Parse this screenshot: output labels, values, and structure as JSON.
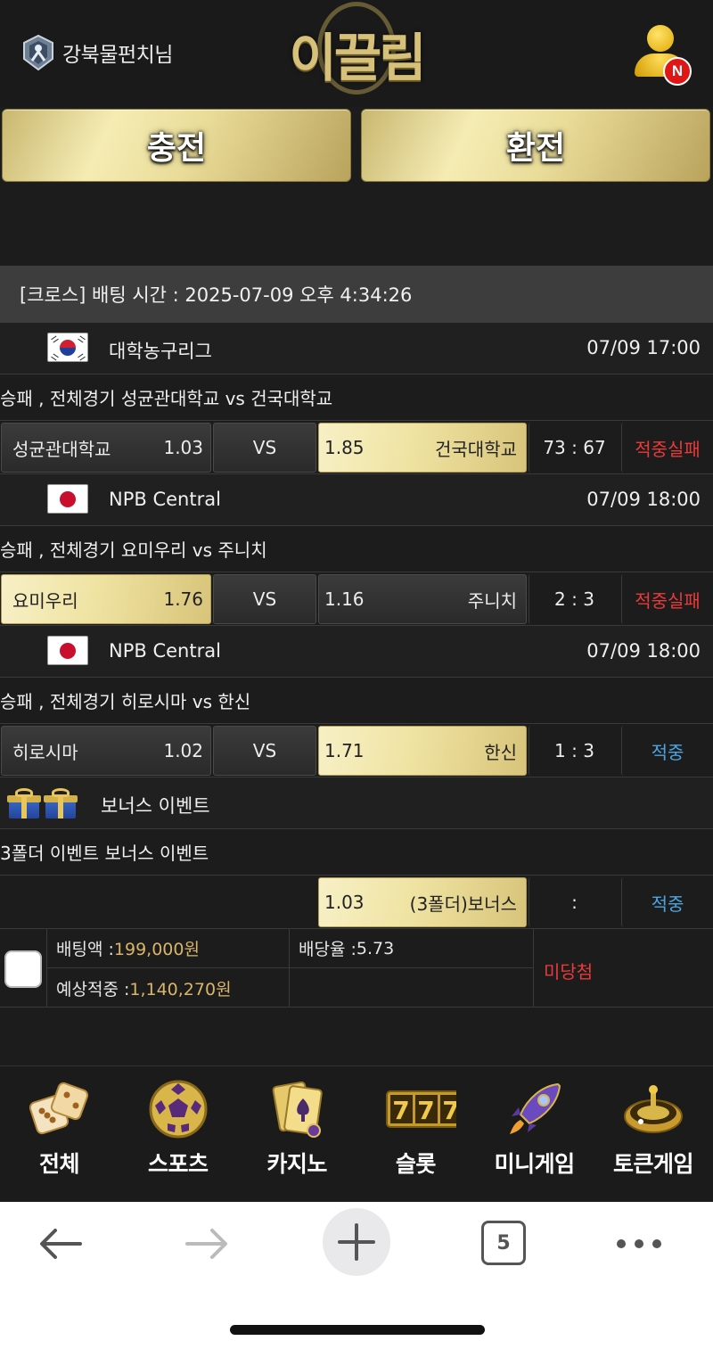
{
  "header": {
    "username": "강북물펀치님",
    "logo_text": "이끌림",
    "notification_badge": "N"
  },
  "actions": {
    "charge_label": "충전",
    "exchange_label": "환전"
  },
  "slip": {
    "title": "[크로스] 배팅 시간 : 2025-07-09 오후 4:34:26",
    "games": [
      {
        "flag": "kr",
        "league": "대학농구리그",
        "time": "07/09 17:00",
        "market": "승패 , 전체경기 성균관대학교  vs  건국대학교",
        "home": "성균관대학교",
        "home_odds": "1.03",
        "vs": "VS",
        "away_odds": "1.85",
        "away": "건국대학교",
        "selected": "away",
        "score": "73 : 67",
        "result": "적중실패",
        "result_color": "#ea3a3a"
      },
      {
        "flag": "jp",
        "league": "NPB Central",
        "time": "07/09 18:00",
        "market": "승패 , 전체경기 요미우리  vs  주니치",
        "home": "요미우리",
        "home_odds": "1.76",
        "vs": "VS",
        "away_odds": "1.16",
        "away": "주니치",
        "selected": "home",
        "score": "2 : 3",
        "result": "적중실패",
        "result_color": "#ea3a3a"
      },
      {
        "flag": "jp",
        "league": "NPB Central",
        "time": "07/09 18:00",
        "market": "승패 , 전체경기 히로시마  vs  한신",
        "home": "히로시마",
        "home_odds": "1.02",
        "vs": "VS",
        "away_odds": "1.71",
        "away": "한신",
        "selected": "away",
        "score": "1 : 3",
        "result": "적중",
        "result_color": "#4aa6e0"
      }
    ],
    "bonus": {
      "league": "보너스 이벤트",
      "market": "3폴더 이벤트 보너스 이벤트",
      "odds": "1.03",
      "label": "(3폴더)보너스",
      "score": ":",
      "result": "적중"
    },
    "summary": {
      "bet_amount_label": "배팅액 : ",
      "bet_amount": "199,000원",
      "odds_label": "배당율 : ",
      "odds": "5.73",
      "expected_label": "예상적중 : ",
      "expected": "1,140,270원",
      "status": "미당첨"
    }
  },
  "game_nav": [
    {
      "label": "전체",
      "icon": "dice-icon"
    },
    {
      "label": "스포츠",
      "icon": "soccer-ball-icon"
    },
    {
      "label": "카지노",
      "icon": "playing-cards-icon"
    },
    {
      "label": "슬롯",
      "icon": "slot-777-icon"
    },
    {
      "label": "미니게임",
      "icon": "rocket-icon"
    },
    {
      "label": "토큰게임",
      "icon": "roulette-icon"
    }
  ],
  "browser": {
    "tab_count": "5"
  },
  "colors": {
    "gold": "#d9b56a",
    "fail": "#ea3a3a",
    "win": "#4aa6e0",
    "background": "#1c1c1c"
  }
}
